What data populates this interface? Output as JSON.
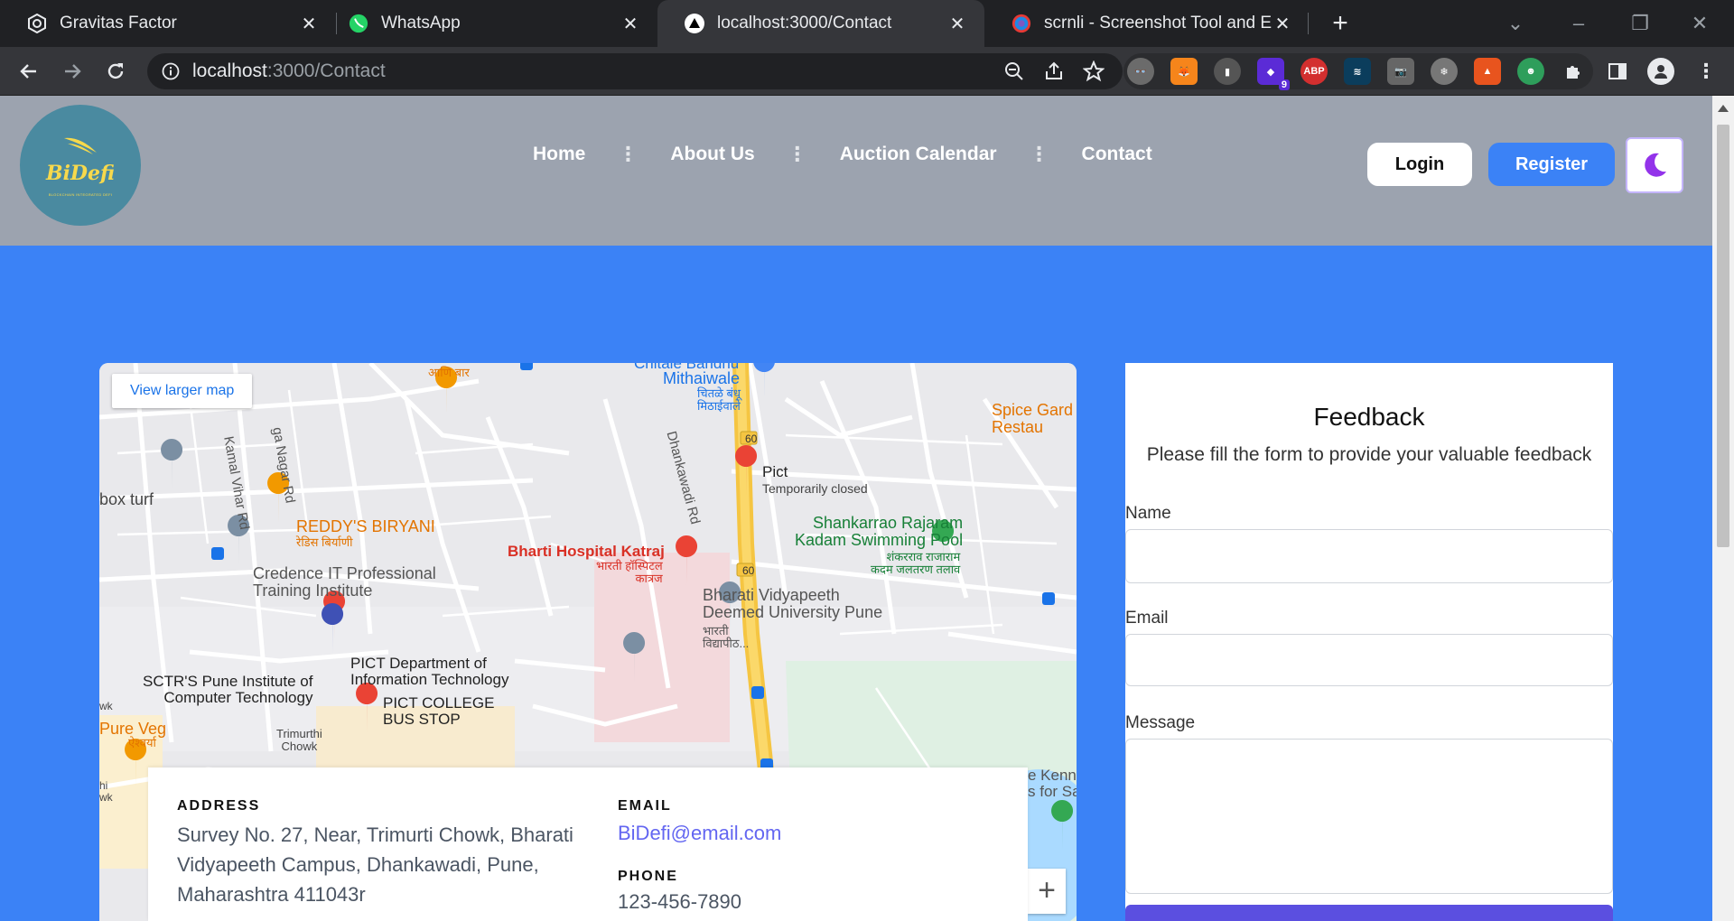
{
  "browser": {
    "tabs": [
      {
        "title": "Gravitas Factor",
        "icon": "gear-hex-icon"
      },
      {
        "title": "WhatsApp",
        "icon": "whatsapp-icon"
      },
      {
        "title": "localhost:3000/Contact",
        "icon": "triangle-icon"
      },
      {
        "title": "scrnli - Screenshot Tool and Edito",
        "icon": "scrnli-icon"
      }
    ],
    "url_host": "localhost",
    "url_path": ":3000/Contact",
    "extension_badge": "9",
    "abp_label": "ABP"
  },
  "site": {
    "logo_text": "BiDefi",
    "logo_tagline": "BLOCKCHAIN INTEGRATED DEFI",
    "nav": [
      "Home",
      "About Us",
      "Auction Calendar",
      "Contact"
    ],
    "nav_separator": "⋮",
    "login_label": "Login",
    "register_label": "Register",
    "theme_icon": "moon-icon",
    "accent": "#3b82f6",
    "header_bg": "#9ca3af"
  },
  "map": {
    "larger_map_label": "View larger map",
    "zoom_in": "+",
    "labels": {
      "chitale": "Chitale Bandhu",
      "mithaiwale": "Mithaiwale",
      "mithaiwale_mr": "चितळे बंधू\nमिठाईवाले",
      "aani_bar": "आणि बार",
      "nagar_rd": "ga Nagar Rd",
      "kamal_vihar": "Kamal Vihar Rd",
      "dhankawadi_rd": "Dhankawadi Rd",
      "spice_garden": "Spice Gard\nRestau",
      "route_60": "60",
      "pict": "Pict",
      "pict_status": "Temporarily closed",
      "box_turf": "box turf",
      "reddys": "REDDY'S BIRYANI",
      "reddys_mr": "रेडिस बिर्याणी",
      "shankarrao": "Shankarrao Rajaram\nKadam Swimming Pool",
      "shankarrao_mr": "शंकरराव राजाराम\nकदम जलतरण तलाव",
      "bharti_hospital": "Bharti Hospital Katraj",
      "bharti_hospital_mr": "भारती हॉस्पिटल\nकात्रज",
      "credence": "Credence IT Professional\nTraining Institute",
      "bharati_vidyapeeth": "Bharati Vidyapeeth\nDeemed University Pune",
      "bharati_mr": "भारती\nविद्यापीठ...",
      "pict_dept": "PICT Department of\nInformation Technology",
      "sctr": "SCTR'S Pune Institute of\nComputer Technology",
      "pict_bus": "PICT COLLEGE\nBUS STOP",
      "wk": "wk",
      "pure_veg": "Pure Veg",
      "pure_veg_mr": "ऐश्वर्या",
      "trimurthi": "Trimurthi\nChowk",
      "hi_wk": "hi\nwk",
      "kenn": "e Kenn\ns for Sa"
    }
  },
  "contact": {
    "address_heading": "ADDRESS",
    "address": "Survey No. 27, Near, Trimurti Chowk, Bharati Vidyapeeth Campus, Dhankawadi, Pune, Maharashtra 411043r",
    "email_heading": "EMAIL",
    "email": "BiDefi@email.com",
    "phone_heading": "PHONE",
    "phone": "123-456-7890"
  },
  "feedback": {
    "title": "Feedback",
    "subtitle": "Please fill the form to provide your valuable feedback",
    "name_label": "Name",
    "email_label": "Email",
    "message_label": "Message",
    "name_value": "",
    "email_value": "",
    "message_value": ""
  }
}
